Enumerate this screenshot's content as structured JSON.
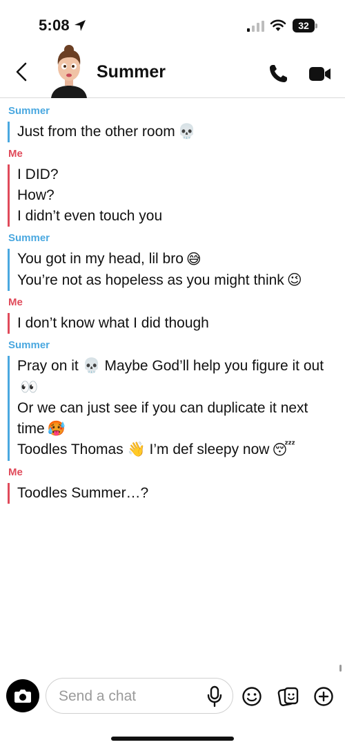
{
  "status_bar": {
    "time": "5:08",
    "battery": "32",
    "icons": [
      "location-arrow-icon",
      "signal-icon",
      "wifi-icon",
      "battery-icon"
    ]
  },
  "header": {
    "contact_name": "Summer",
    "icons": [
      "back-chevron-icon",
      "bitmoji-avatar",
      "phone-icon",
      "video-camera-icon"
    ]
  },
  "colors": {
    "summer": "#4aa8e0",
    "me": "#e04a5a"
  },
  "messages": [
    {
      "sender": "Summer",
      "lines": [
        {
          "text": "Just from the other room",
          "emoji": "skull"
        }
      ]
    },
    {
      "sender": "Me",
      "lines": [
        {
          "text": "I DID?"
        },
        {
          "text": "How?"
        },
        {
          "text": "I didn’t even touch you"
        }
      ]
    },
    {
      "sender": "Summer",
      "lines": [
        {
          "text": "You got in my head, lil bro",
          "emoji": "grin-sweat"
        },
        {
          "text": "You’re not as hopeless as you might think",
          "emoji": "wink"
        }
      ]
    },
    {
      "sender": "Me",
      "lines": [
        {
          "text": "I don’t know what I did though"
        }
      ]
    },
    {
      "sender": "Summer",
      "lines": [
        {
          "text": "Pray on it 💀 Maybe God’ll help you figure it out",
          "emoji": "eyes"
        },
        {
          "text": "Or we can just see if you can duplicate it next time",
          "emoji": "hot-face"
        },
        {
          "text": "Toodles Thomas 👋 I’m def sleepy now",
          "emoji": "sleepy"
        }
      ]
    },
    {
      "sender": "Me",
      "lines": [
        {
          "text": "Toodles Summer…?"
        }
      ]
    }
  ],
  "composer": {
    "placeholder": "Send a chat",
    "icons": [
      "camera-icon",
      "microphone-icon",
      "emoji-icon",
      "sticker-icon",
      "plus-icon"
    ]
  }
}
